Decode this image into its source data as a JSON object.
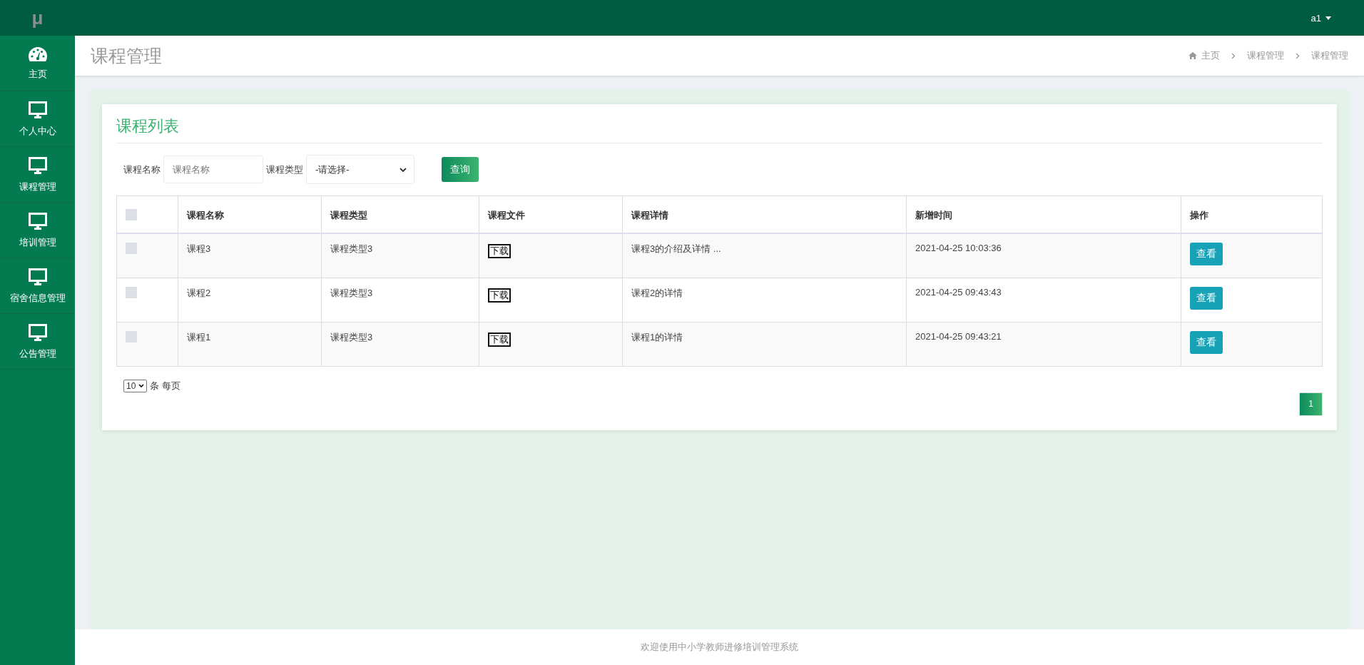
{
  "logo": "μ",
  "user": {
    "name": "a1"
  },
  "sidebar": {
    "items": [
      {
        "label": "主页",
        "kind": "dashboard"
      },
      {
        "label": "个人中心",
        "kind": "page"
      },
      {
        "label": "课程管理",
        "kind": "page"
      },
      {
        "label": "培训管理",
        "kind": "page"
      },
      {
        "label": "宿舍信息管理",
        "kind": "page"
      },
      {
        "label": "公告管理",
        "kind": "page"
      }
    ]
  },
  "header": {
    "title": "课程管理",
    "breadcrumb": [
      "主页",
      "课程管理",
      "课程管理"
    ]
  },
  "card": {
    "title": "课程列表",
    "filters": {
      "name_label": "课程名称",
      "name_placeholder": "课程名称",
      "type_label": "课程类型",
      "type_value": "-请选择-",
      "search_button": "查询"
    },
    "table": {
      "select_all_checked": false,
      "columns": [
        "课程名称",
        "课程类型",
        "课程文件",
        "课程详情",
        "新增时间",
        "操作"
      ],
      "rows": [
        {
          "checked": false,
          "name": "课程3",
          "type": "课程类型3",
          "file": "下载",
          "detail": "课程3的介绍及详情 ...",
          "time": "2021-04-25 10:03:36",
          "action": "查看"
        },
        {
          "checked": false,
          "name": "课程2",
          "type": "课程类型3",
          "file": "下载",
          "detail": "课程2的详情",
          "time": "2021-04-25 09:43:43",
          "action": "查看"
        },
        {
          "checked": false,
          "name": "课程1",
          "type": "课程类型3",
          "file": "下载",
          "detail": "课程1的详情",
          "time": "2021-04-25 09:43:21",
          "action": "查看"
        }
      ]
    },
    "page_size": {
      "value": "10",
      "label": "条 每页"
    },
    "pages": [
      {
        "label": "1",
        "selected": true
      }
    ]
  },
  "footer": "欢迎使用中小学教师进修培训管理系统"
}
